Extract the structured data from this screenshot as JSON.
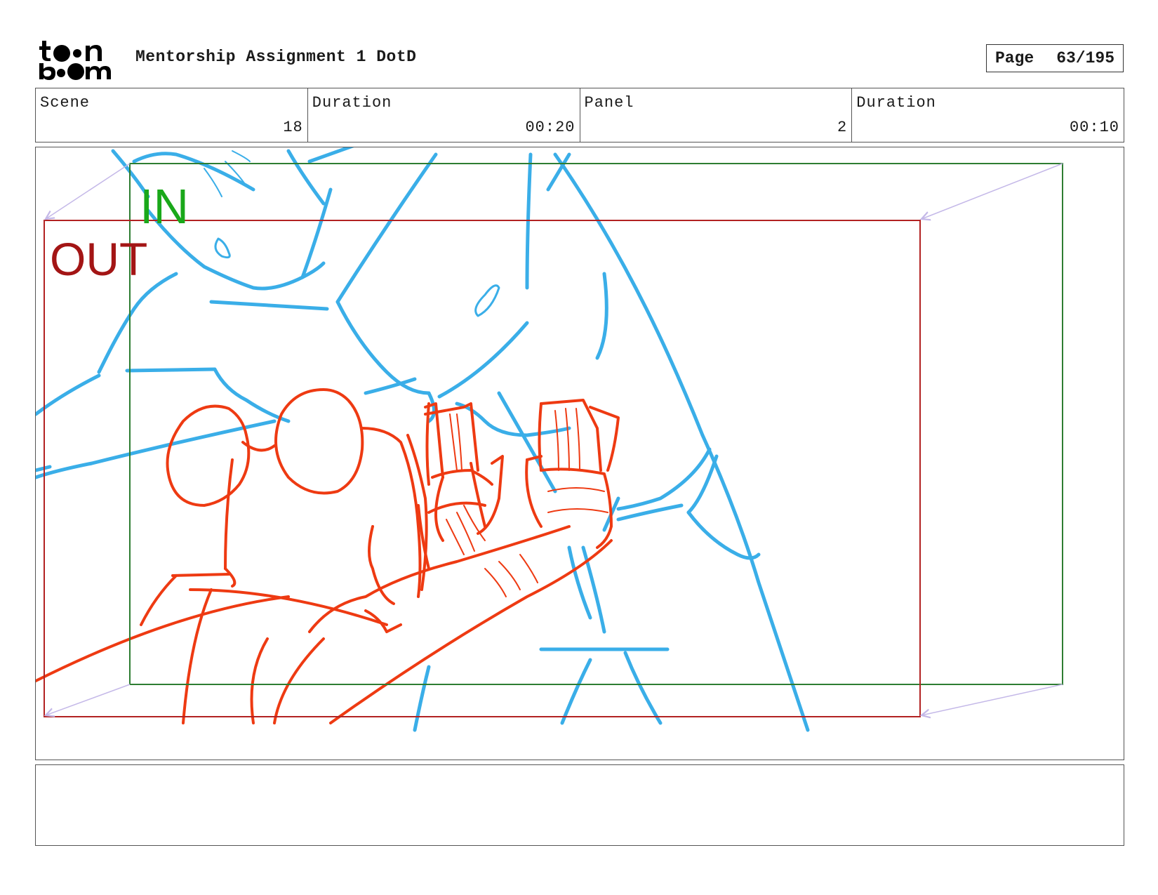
{
  "header": {
    "logo_text": "toon boom",
    "title": "Mentorship Assignment 1 DotD",
    "page_label": "Page",
    "page_value": "63/195"
  },
  "info": [
    {
      "label": "Scene",
      "value": "18"
    },
    {
      "label": "Duration",
      "value": "00:20"
    },
    {
      "label": "Panel",
      "value": "2"
    },
    {
      "label": "Duration",
      "value": "00:10"
    }
  ],
  "panel": {
    "in_label": "IN",
    "out_label": "OUT",
    "colors": {
      "in_frame": "#2e7d32",
      "in_text": "#1aa81a",
      "out_frame": "#b22222",
      "out_text": "#a31515",
      "guide_arrows": "#c4b8e8",
      "sketch_blue": "#3aaee8",
      "sketch_red": "#ee3a12"
    }
  },
  "notes": {
    "text": ""
  }
}
